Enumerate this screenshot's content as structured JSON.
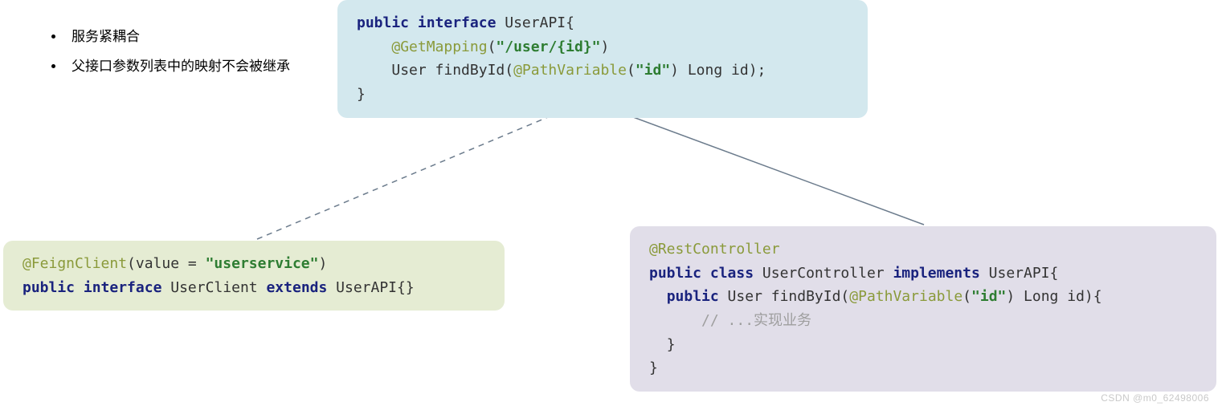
{
  "bullets": {
    "b1": "服务紧耦合",
    "b2": "父接口参数列表中的映射不会被继承"
  },
  "top": {
    "kw_public": "public",
    "kw_interface": "interface",
    "cls": " UserAPI{",
    "ann_get": "@GetMapping",
    "paren_open": "(",
    "str_path": "\"/user/{id}\"",
    "paren_close": ")",
    "line3a": "User findById(",
    "ann_pv": "@PathVariable",
    "paren_open2": "(",
    "str_id": "\"id\"",
    "line3b": ") Long id);",
    "close": "}"
  },
  "left": {
    "ann_feign": "@FeignClient",
    "p1": "(value = ",
    "str_svc": "\"userservice\"",
    "p2": ")",
    "kw_public": "public",
    "kw_interface": "interface",
    "mid": " UserClient ",
    "kw_extends": "extends",
    "tail": " UserAPI{}"
  },
  "right": {
    "ann_rest": "@RestController",
    "kw_public": "public",
    "kw_class": "class",
    "mid": " UserController ",
    "kw_impl": "implements",
    "tail": " UserAPI{",
    "kw_public2": "public",
    "sig_a": " User findById(",
    "ann_pv": "@PathVariable",
    "p1": "(",
    "str_id": "\"id\"",
    "sig_b": ") Long id){",
    "cmt": "// ...实现业务",
    "close_inner": "}",
    "close_outer": "}"
  },
  "watermark": "CSDN @m0_62498006"
}
